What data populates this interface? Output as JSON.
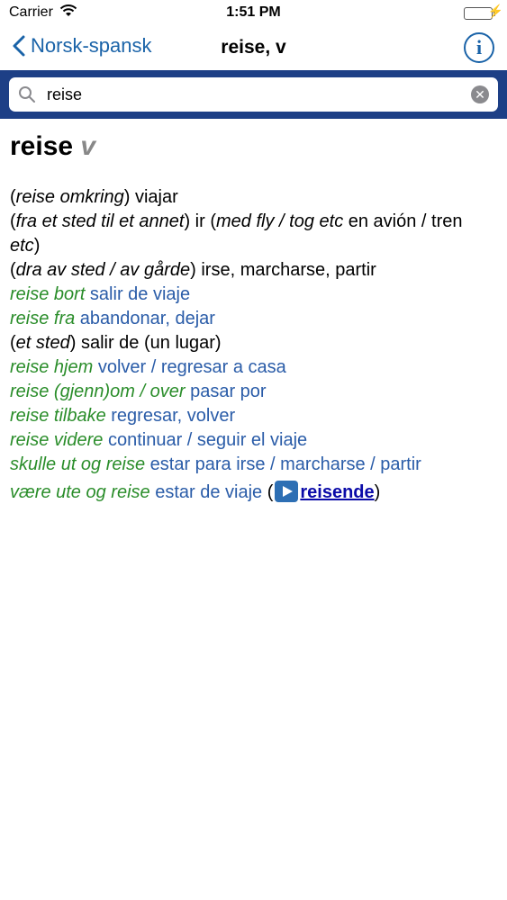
{
  "status": {
    "carrier": "Carrier",
    "time": "1:51 PM"
  },
  "nav": {
    "back_label": "Norsk-spansk",
    "title": "reise, v",
    "info_label": "i"
  },
  "search": {
    "value": "reise"
  },
  "entry": {
    "headword": "reise",
    "pos": "v",
    "lines": [
      {
        "p1": "(",
        "i1": "reise omkring",
        "p2": ")",
        "t1": " viajar"
      },
      {
        "p1": "(",
        "i1": "fra et sted til et annet",
        "p2": ")",
        "t1": " ir (",
        "i2": "med fly / tog etc",
        "t2": " en avión / tren ",
        "i3": "etc",
        "t3": ")"
      },
      {
        "p1": "(",
        "i1": "dra av sted / av gårde",
        "p2": ")",
        "t1": " irse, marcharse, partir"
      },
      {
        "phrase": "reise bort",
        "trans": " salir de viaje"
      },
      {
        "phrase": "reise fra",
        "trans": " abandonar, dejar"
      },
      {
        "p1": "(",
        "i1": "et sted",
        "p2": ")",
        "t1": " salir de (un lugar)"
      },
      {
        "phrase": "reise hjem",
        "trans": " volver / regresar a casa"
      },
      {
        "phrase": "reise (gjenn)om / over",
        "trans": " pasar por"
      },
      {
        "phrase": "reise tilbake",
        "trans": " regresar, volver"
      },
      {
        "phrase": "reise videre",
        "trans": " continuar / seguir el viaje"
      },
      {
        "phrase": "skulle ut og reise",
        "trans": " estar para irse / marcharse / partir"
      },
      {
        "phrase": "være ute og reise",
        "trans": " estar de viaje",
        "open": " (",
        "xref": "reisende",
        "close": ")"
      }
    ]
  }
}
